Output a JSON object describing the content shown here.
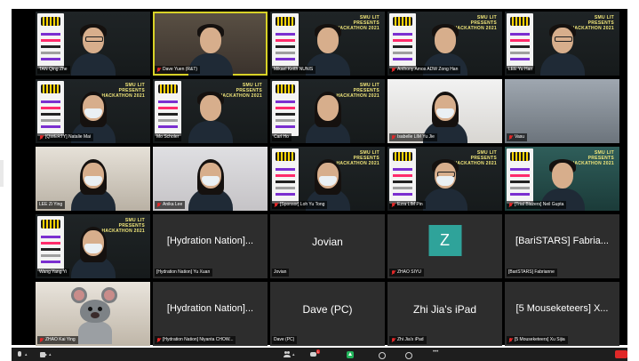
{
  "participants": [
    {
      "id": "p1",
      "name": "TAN Qing Zhe",
      "muted": false,
      "type": "video",
      "bg": "bg-dark",
      "poster": true,
      "hacktext": false
    },
    {
      "id": "p2",
      "name": "Dave Yuen (R&T)",
      "muted": true,
      "type": "video",
      "bg": "",
      "poster": false,
      "hacktext": false,
      "active": true
    },
    {
      "id": "p3",
      "name": "Mikael Keith NUNIS",
      "muted": false,
      "type": "video",
      "bg": "bg-dark",
      "poster": true,
      "hacktext": true
    },
    {
      "id": "p4",
      "name": "Anthony Amos ADW Zong Han",
      "muted": true,
      "type": "video",
      "bg": "bg-dark",
      "poster": true,
      "hacktext": true
    },
    {
      "id": "p5",
      "name": "LEE Yu Han",
      "muted": false,
      "type": "video",
      "bg": "bg-dark",
      "poster": true,
      "hacktext": true
    },
    {
      "id": "p6",
      "name": "[QWERTY] Natalie Mai",
      "muted": true,
      "type": "video",
      "bg": "bg-dark",
      "poster": true,
      "hacktext": true
    },
    {
      "id": "p7",
      "name": "Mo Scholer",
      "muted": false,
      "type": "video",
      "bg": "bg-dark",
      "poster": true,
      "hacktext": true
    },
    {
      "id": "p8",
      "name": "Carl Ho",
      "muted": false,
      "type": "video",
      "bg": "bg-dark",
      "poster": true,
      "hacktext": true
    },
    {
      "id": "p9",
      "name": "Isabelle LIM Yu Jie",
      "muted": true,
      "type": "video",
      "bg": "bg-white",
      "poster": false,
      "hacktext": false
    },
    {
      "id": "p10",
      "name": "Vasu",
      "muted": true,
      "type": "video",
      "bg": "bg-bluegrey",
      "poster": false,
      "hacktext": false
    },
    {
      "id": "p11",
      "name": "LEE Zi Ying",
      "muted": false,
      "type": "video",
      "bg": "bg-room",
      "poster": false,
      "hacktext": false
    },
    {
      "id": "p12",
      "name": "Anika Lee",
      "muted": true,
      "type": "video",
      "bg": "bg-light",
      "poster": false,
      "hacktext": false
    },
    {
      "id": "p13",
      "name": "[Sponsor] Loh Yu Tong",
      "muted": true,
      "type": "video",
      "bg": "bg-dark",
      "poster": true,
      "hacktext": true
    },
    {
      "id": "p14",
      "name": "Ezra LIM Pin",
      "muted": true,
      "type": "video",
      "bg": "bg-dark",
      "poster": true,
      "hacktext": true
    },
    {
      "id": "p15",
      "name": "[Trial Blazers] Neil Gupta",
      "muted": true,
      "type": "video",
      "bg": "bg-teal",
      "poster": true,
      "hacktext": true
    },
    {
      "id": "p16",
      "name": "Wang Yang Yi",
      "muted": false,
      "type": "video",
      "bg": "bg-dark",
      "poster": true,
      "hacktext": true
    },
    {
      "id": "p17",
      "name": "[Hydration Nation] Yu Xuan",
      "muted": false,
      "type": "text",
      "label": "[Hydration Nation]..."
    },
    {
      "id": "p18",
      "name": "Jovian",
      "muted": false,
      "type": "text",
      "label": "Jovian"
    },
    {
      "id": "p19",
      "name": "ZHAO SIYU",
      "muted": true,
      "type": "avatar",
      "label": "Z"
    },
    {
      "id": "p20",
      "name": "[BariSTARS] Fabrianne",
      "muted": false,
      "type": "text",
      "label": "[BariSTARS] Fabria..."
    },
    {
      "id": "p21",
      "name": "ZHAO Kai Ying",
      "muted": true,
      "type": "rat"
    },
    {
      "id": "p22",
      "name": "[Hydration Nation] Niyanta CHOW...",
      "muted": true,
      "type": "text",
      "label": "[Hydration Nation]..."
    },
    {
      "id": "p23",
      "name": "Dave (PC)",
      "muted": false,
      "type": "text",
      "label": "Dave (PC)"
    },
    {
      "id": "p24",
      "name": "Zhi Jia's iPad",
      "muted": true,
      "type": "text",
      "label": "Zhi Jia's iPad"
    },
    {
      "id": "p25",
      "name": "[5 Mouseketeers] Xu Sijia",
      "muted": true,
      "type": "text",
      "label": "[5 Mouseketeers] X..."
    }
  ],
  "hackathon_lines": [
    "SMU LIT",
    "PRESENTS",
    "HACKATHON 2021"
  ],
  "toolbar": {
    "chat_badge": "1"
  },
  "colors": {
    "active_border": "#d8d227",
    "avatar_bg": "#2fa39a",
    "muted_icon": "#e02828",
    "share_green": "#21b35a",
    "end_red": "#e02828"
  }
}
